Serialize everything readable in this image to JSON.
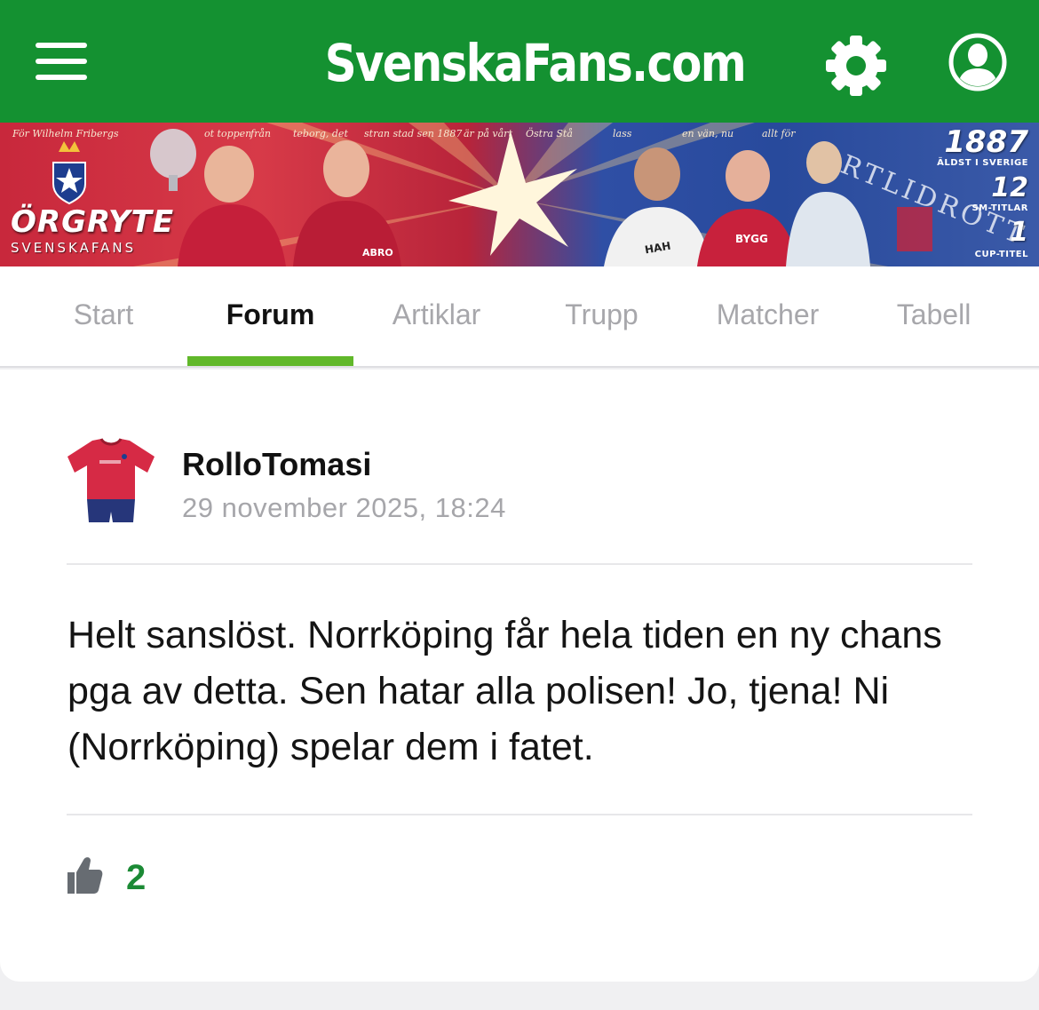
{
  "header": {
    "logo_text": "SvenskaFans.com",
    "menu_icon": "hamburger-menu-icon",
    "settings_icon": "gear-icon",
    "profile_icon": "user-profile-icon",
    "background_color": "#149131"
  },
  "banner": {
    "brand_title": "ÖRGRYTE",
    "brand_subtitle": "SVENSKAFANS",
    "quote_left": "För Wilhelm Fribergs",
    "quote_mid1": "ot toppen",
    "quote_mid2": "från",
    "quote_mid3": "teborg, det",
    "quote_mid4": "stran stad sen 1887",
    "quote_mid5": "är på vårt",
    "quote_mid6": "Östra Stå",
    "quote_right1": "lass",
    "quote_right2": "en vän, nu",
    "quote_right3": "allt för",
    "vertical_text": "RTLIDROTT",
    "stats": [
      {
        "number": "1887",
        "label": "ÄLDST I SVERIGE"
      },
      {
        "number": "12",
        "label": "SM-TITLAR"
      },
      {
        "number": "1",
        "label": "CUP-TITEL"
      }
    ],
    "shirt_text_1": "BYGG",
    "shirt_text_2": "ABRO",
    "shirt_text_3": "HAH"
  },
  "tabs": [
    {
      "label": "Start",
      "active": false
    },
    {
      "label": "Forum",
      "active": true
    },
    {
      "label": "Artiklar",
      "active": false
    },
    {
      "label": "Trupp",
      "active": false
    },
    {
      "label": "Matcher",
      "active": false
    },
    {
      "label": "Tabell",
      "active": false
    }
  ],
  "accent_color": "#61b82a",
  "post": {
    "avatar_icon": "jersey-avatar-icon",
    "username": "RolloTomasi",
    "timestamp": "29 november 2025, 18:24",
    "text": "Helt sanslöst. Norrköping får hela tiden en ny chans pga av detta. Sen hatar alla polisen! Jo, tjena! Ni (Norrköping) spelar dem i fatet.",
    "like_icon": "thumbs-up-icon",
    "like_count": "2",
    "like_color": "#1b8a35"
  }
}
